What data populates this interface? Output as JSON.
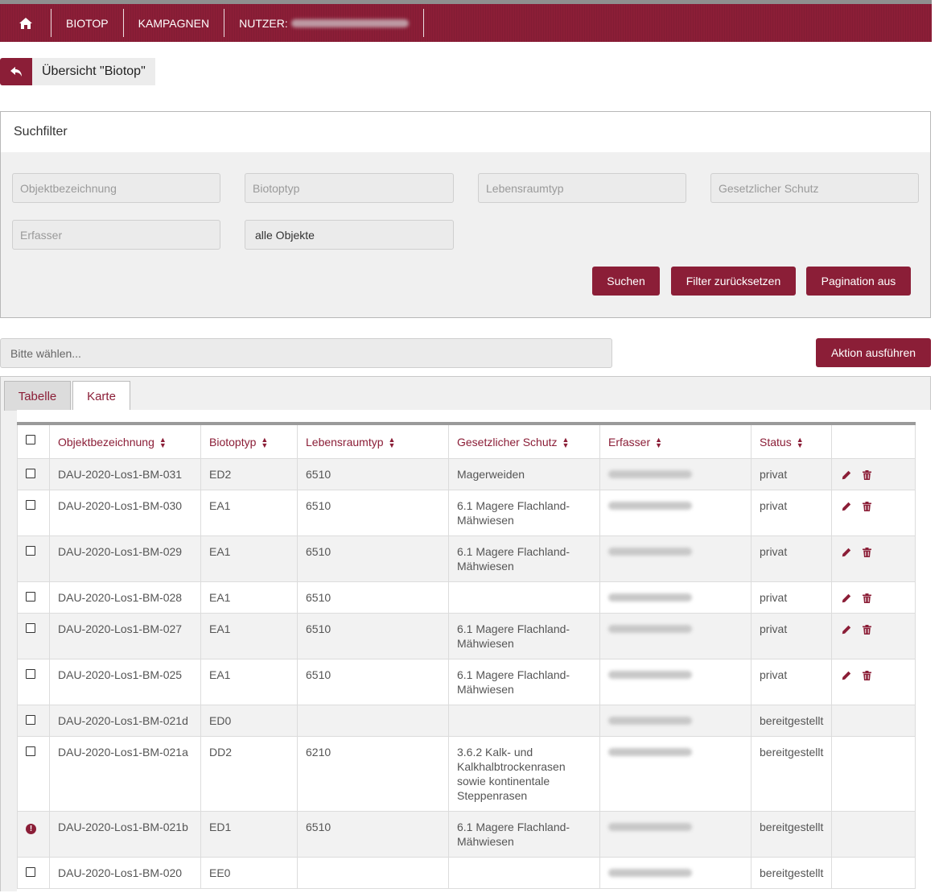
{
  "nav": {
    "home_icon": "home-icon",
    "biotop": "BIOTOP",
    "kampagnen": "KAMPAGNEN",
    "nutzer": "NUTZER:"
  },
  "back": {
    "icon": "reply-arrow-icon",
    "label": "Übersicht \"Biotop\""
  },
  "filter": {
    "title": "Suchfilter",
    "placeholders": {
      "objekt": "Objektbezeichnung",
      "biotoptyp": "Biotoptyp",
      "lebensraumtyp": "Lebensraumtyp",
      "schutz": "Gesetzlicher Schutz",
      "erfasser": "Erfasser"
    },
    "status_select": "alle Objekte",
    "buttons": {
      "search": "Suchen",
      "reset": "Filter zurücksetzen",
      "pagination": "Pagination aus"
    }
  },
  "bulk": {
    "placeholder": "Bitte wählen...",
    "action": "Aktion ausführen"
  },
  "tabs": {
    "table": "Tabelle",
    "map": "Karte"
  },
  "table": {
    "headers": [
      "Objektbezeichnung",
      "Biotoptyp",
      "Lebensraumtyp",
      "Gesetzlicher Schutz",
      "Erfasser",
      "Status"
    ],
    "rows": [
      {
        "name": "DAU-2020-Los1-BM-031",
        "biotoptyp": "ED2",
        "lrt": "6510",
        "schutz": "Magerweiden",
        "status": "privat",
        "actions": true,
        "alert": false
      },
      {
        "name": "DAU-2020-Los1-BM-030",
        "biotoptyp": "EA1",
        "lrt": "6510",
        "schutz": "6.1 Magere Flachland-Mähwiesen",
        "status": "privat",
        "actions": true,
        "alert": false
      },
      {
        "name": "DAU-2020-Los1-BM-029",
        "biotoptyp": "EA1",
        "lrt": "6510",
        "schutz": "6.1 Magere Flachland-Mähwiesen",
        "status": "privat",
        "actions": true,
        "alert": false
      },
      {
        "name": "DAU-2020-Los1-BM-028",
        "biotoptyp": "EA1",
        "lrt": "6510",
        "schutz": "",
        "status": "privat",
        "actions": true,
        "alert": false
      },
      {
        "name": "DAU-2020-Los1-BM-027",
        "biotoptyp": "EA1",
        "lrt": "6510",
        "schutz": "6.1 Magere Flachland-Mähwiesen",
        "status": "privat",
        "actions": true,
        "alert": false
      },
      {
        "name": "DAU-2020-Los1-BM-025",
        "biotoptyp": "EA1",
        "lrt": "6510",
        "schutz": "6.1 Magere Flachland-Mähwiesen",
        "status": "privat",
        "actions": true,
        "alert": false
      },
      {
        "name": "DAU-2020-Los1-BM-021d",
        "biotoptyp": "ED0",
        "lrt": "",
        "schutz": "",
        "status": "bereitgestellt",
        "actions": false,
        "alert": false
      },
      {
        "name": "DAU-2020-Los1-BM-021a",
        "biotoptyp": "DD2",
        "lrt": "6210",
        "schutz": "3.6.2 Kalk- und Kalkhalbtrockenrasen sowie kontinentale Steppenrasen",
        "status": "bereitgestellt",
        "actions": false,
        "alert": false
      },
      {
        "name": "DAU-2020-Los1-BM-021b",
        "biotoptyp": "ED1",
        "lrt": "6510",
        "schutz": "6.1 Magere Flachland-Mähwiesen",
        "status": "bereitgestellt",
        "actions": false,
        "alert": true
      },
      {
        "name": "DAU-2020-Los1-BM-020",
        "biotoptyp": "EE0",
        "lrt": "",
        "schutz": "",
        "status": "bereitgestellt",
        "actions": false,
        "alert": false
      }
    ]
  },
  "colors": {
    "brand": "#8b1e37",
    "panel": "#f0f0f0"
  }
}
